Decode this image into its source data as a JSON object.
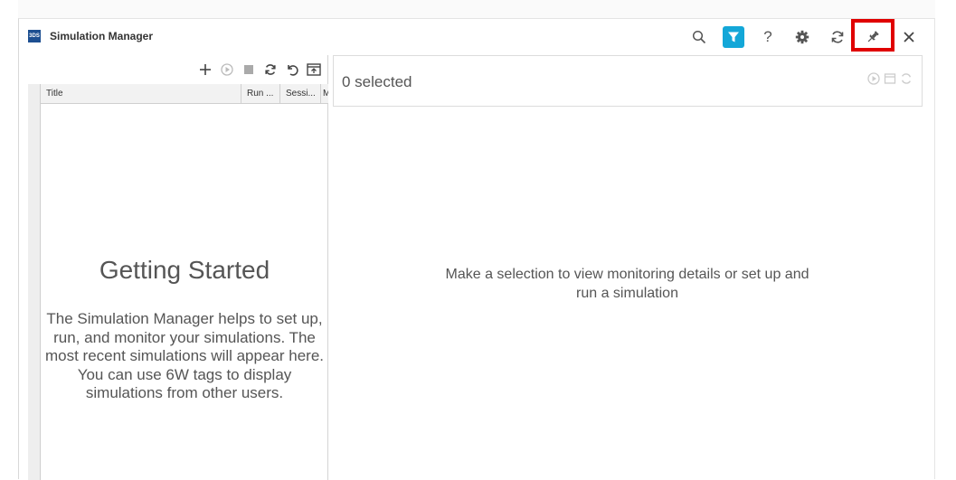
{
  "window": {
    "title": "Simulation Manager",
    "logo_text": "3DS"
  },
  "toolbar": {
    "icons": [
      "search-icon",
      "filter-icon",
      "help-icon",
      "gear-icon",
      "refresh-icon",
      "pin-icon",
      "close-icon"
    ],
    "filter_color": "#13a7d8",
    "highlight_color": "#e00000"
  },
  "left_panel": {
    "toolbar_icons": [
      "add-icon",
      "play-icon",
      "stop-icon",
      "refresh-icon",
      "undo-icon",
      "export-icon"
    ],
    "columns": [
      "Title",
      "Run ...",
      "Sessi...",
      "M"
    ],
    "getting_started": {
      "title": "Getting Started",
      "text": "The Simulation Manager helps to set up, run, and monitor your simulations. The most recent simulations will appear here. You can use 6W tags to display simulations from other users."
    }
  },
  "right_panel": {
    "selected_label": "0 selected",
    "header_icons": [
      "play-icon",
      "calendar-icon",
      "refresh-icon"
    ],
    "empty_message": "Make a selection to view monitoring details or set up and run a simulation"
  }
}
